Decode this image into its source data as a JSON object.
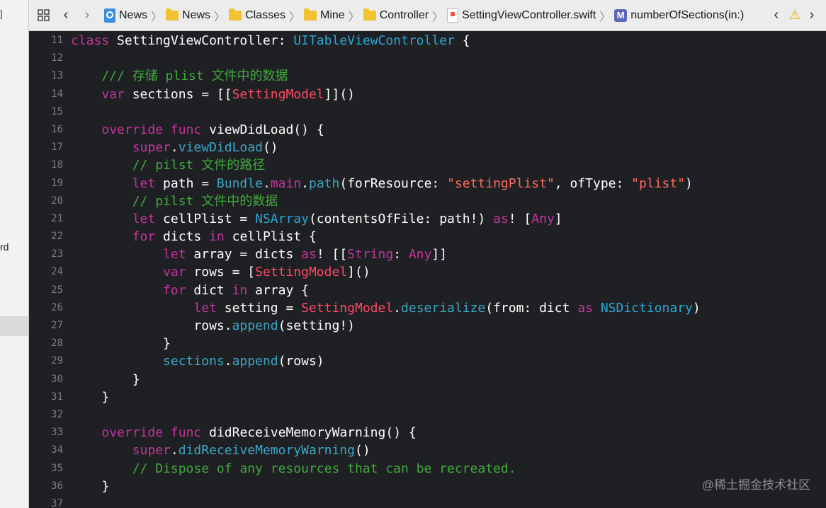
{
  "left_strip": {
    "top_fragment": "]",
    "word_fragment": "rd"
  },
  "jumpbar": {
    "crumbs": [
      "News",
      "News",
      "Classes",
      "Mine",
      "Controller",
      "SettingViewController.swift",
      "numberOfSections(in:)"
    ],
    "method_badge": "M",
    "icons": [
      "grid-icon",
      "back-arrow",
      "forward-arrow",
      "xcodeproj-icon",
      "folder-icon",
      "swift-file-icon",
      "method-icon",
      "warning-icon"
    ]
  },
  "editor": {
    "line_numbers": [
      "11",
      "12",
      "13",
      "14",
      "15",
      "16",
      "17",
      "18",
      "19",
      "20",
      "21",
      "22",
      "23",
      "24",
      "25",
      "26",
      "27",
      "28",
      "29",
      "30",
      "31",
      "32",
      "33",
      "34",
      "35",
      "36",
      "37"
    ],
    "lines": [
      [
        [
          "kw",
          "class"
        ],
        [
          "p",
          " SettingViewController: "
        ],
        [
          "ty",
          "UITableViewController"
        ],
        [
          "p",
          " {"
        ]
      ],
      [],
      [
        [
          "cmt",
          "    /// 存储 plist 文件中的数据"
        ]
      ],
      [
        [
          "p",
          "    "
        ],
        [
          "kw",
          "var"
        ],
        [
          "p",
          " sections = [["
        ],
        [
          "red",
          "SettingModel"
        ],
        [
          "p",
          "]]()"
        ]
      ],
      [],
      [
        [
          "p",
          "    "
        ],
        [
          "kw",
          "override"
        ],
        [
          "p",
          " "
        ],
        [
          "kw",
          "func"
        ],
        [
          "p",
          " viewDidLoad() {"
        ]
      ],
      [
        [
          "p",
          "        "
        ],
        [
          "kw",
          "super"
        ],
        [
          "p",
          "."
        ],
        [
          "meth",
          "viewDidLoad"
        ],
        [
          "p",
          "()"
        ]
      ],
      [
        [
          "cmt",
          "        // pilst 文件的路径"
        ]
      ],
      [
        [
          "p",
          "        "
        ],
        [
          "kw",
          "let"
        ],
        [
          "p",
          " path = "
        ],
        [
          "meth",
          "Bundle"
        ],
        [
          "p",
          "."
        ],
        [
          "kw",
          "main"
        ],
        [
          "p",
          "."
        ],
        [
          "meth",
          "path"
        ],
        [
          "p",
          "(forResource: "
        ],
        [
          "str",
          "\"settingPlist\""
        ],
        [
          "p",
          ", ofType: "
        ],
        [
          "str",
          "\"plist\""
        ],
        [
          "p",
          ")"
        ]
      ],
      [
        [
          "cmt",
          "        // pilst 文件中的数据"
        ]
      ],
      [
        [
          "p",
          "        "
        ],
        [
          "kw",
          "let"
        ],
        [
          "p",
          " cellPlist = "
        ],
        [
          "ty",
          "NSArray"
        ],
        [
          "p",
          "(contentsOfFile: path!) "
        ],
        [
          "kw",
          "as"
        ],
        [
          "p",
          "! ["
        ],
        [
          "kw",
          "Any"
        ],
        [
          "p",
          "]"
        ]
      ],
      [
        [
          "p",
          "        "
        ],
        [
          "kw",
          "for"
        ],
        [
          "p",
          " dicts "
        ],
        [
          "kw",
          "in"
        ],
        [
          "p",
          " cellPlist {"
        ]
      ],
      [
        [
          "p",
          "            "
        ],
        [
          "kw",
          "let"
        ],
        [
          "p",
          " array = dicts "
        ],
        [
          "kw",
          "as"
        ],
        [
          "p",
          "! [["
        ],
        [
          "kw",
          "String"
        ],
        [
          "p",
          ": "
        ],
        [
          "kw",
          "Any"
        ],
        [
          "p",
          "]]"
        ]
      ],
      [
        [
          "p",
          "            "
        ],
        [
          "kw",
          "var"
        ],
        [
          "p",
          " rows = ["
        ],
        [
          "red",
          "SettingModel"
        ],
        [
          "p",
          "]()"
        ]
      ],
      [
        [
          "p",
          "            "
        ],
        [
          "kw",
          "for"
        ],
        [
          "p",
          " dict "
        ],
        [
          "kw",
          "in"
        ],
        [
          "p",
          " array {"
        ]
      ],
      [
        [
          "p",
          "                "
        ],
        [
          "kw",
          "let"
        ],
        [
          "p",
          " setting = "
        ],
        [
          "red",
          "SettingModel"
        ],
        [
          "p",
          "."
        ],
        [
          "meth",
          "deserialize"
        ],
        [
          "p",
          "(from: dict "
        ],
        [
          "kw",
          "as"
        ],
        [
          "p",
          " "
        ],
        [
          "ty",
          "NSDictionary"
        ],
        [
          "p",
          ")"
        ]
      ],
      [
        [
          "p",
          "                rows."
        ],
        [
          "meth",
          "append"
        ],
        [
          "p",
          "(setting!)"
        ]
      ],
      [
        [
          "p",
          "            }"
        ]
      ],
      [
        [
          "p",
          "            "
        ],
        [
          "meth",
          "sections"
        ],
        [
          "p",
          "."
        ],
        [
          "meth",
          "append"
        ],
        [
          "p",
          "(rows)"
        ]
      ],
      [
        [
          "p",
          "        }"
        ]
      ],
      [
        [
          "p",
          "    }"
        ]
      ],
      [],
      [
        [
          "p",
          "    "
        ],
        [
          "kw",
          "override"
        ],
        [
          "p",
          " "
        ],
        [
          "kw",
          "func"
        ],
        [
          "p",
          " didReceiveMemoryWarning() {"
        ]
      ],
      [
        [
          "p",
          "        "
        ],
        [
          "kw",
          "super"
        ],
        [
          "p",
          "."
        ],
        [
          "meth",
          "didReceiveMemoryWarning"
        ],
        [
          "p",
          "()"
        ]
      ],
      [
        [
          "cmt",
          "        // Dispose of any resources that can be recreated."
        ]
      ],
      [
        [
          "p",
          "    }"
        ]
      ],
      []
    ]
  },
  "watermark": "@稀土掘金技术社区",
  "colors": {
    "background": "#1f2023",
    "keyword": "#c2349b",
    "type": "#29a6d6",
    "comment": "#40a93e",
    "string": "#fc6a5d",
    "project_type": "#ff4866",
    "method": "#3ca5c4"
  }
}
